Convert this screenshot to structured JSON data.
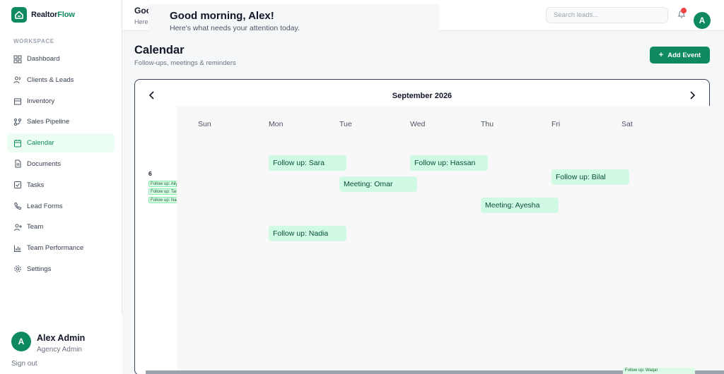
{
  "brand": {
    "name_part1": "Realtor",
    "name_part2": "Flow"
  },
  "sidebar": {
    "section_label": "WORKSPACE",
    "items": [
      {
        "label": "Dashboard",
        "icon": "grid-icon"
      },
      {
        "label": "Clients & Leads",
        "icon": "users-icon"
      },
      {
        "label": "Inventory",
        "icon": "building-icon"
      },
      {
        "label": "Sales Pipeline",
        "icon": "pipeline-icon"
      },
      {
        "label": "Calendar",
        "icon": "calendar-icon",
        "active": true
      },
      {
        "label": "Documents",
        "icon": "document-icon"
      },
      {
        "label": "Tasks",
        "icon": "checkbox-icon"
      },
      {
        "label": "Lead Forms",
        "icon": "phone-icon"
      },
      {
        "label": "Team",
        "icon": "user-plus-icon"
      },
      {
        "label": "Team Performance",
        "icon": "bar-chart-icon"
      },
      {
        "label": "Settings",
        "icon": "gear-icon"
      }
    ],
    "user": {
      "initial": "A",
      "name": "Alex Admin",
      "role": "Agency Admin",
      "signout": "Sign out"
    }
  },
  "topbar": {
    "greeting_clipped": "Goo",
    "sub_clipped": "Here",
    "search_placeholder": "Search leads...",
    "avatar_initial": "A"
  },
  "greeting": {
    "title": "Good morning, Alex!",
    "subtitle": "Here's what needs your attention today."
  },
  "page": {
    "title": "Calendar",
    "subtitle": "Follow-ups, meetings & reminders",
    "add_button": "Add Event"
  },
  "calendar": {
    "month": "September 2026",
    "underlay_day": "6",
    "underlay_chips": [
      "Follow up: Aliya",
      "Follow up: Tariq",
      "Follow up: Nadia"
    ],
    "weekdays": [
      "Sun",
      "Mon",
      "Tue",
      "Wed",
      "Thu",
      "Fri",
      "Sat"
    ],
    "events": [
      {
        "label": "Follow up: Sara"
      },
      {
        "label": "Follow up: Hassan"
      },
      {
        "label": "Follow up: Bilal"
      },
      {
        "label": "Meeting: Omar"
      },
      {
        "label": "Meeting: Ayesha"
      },
      {
        "label": "Follow up: Nadia"
      }
    ],
    "bottom_chip": "Follow up: Waqar"
  },
  "colors": {
    "accent": "#0f8a5f",
    "event_bg": "#d1fae5",
    "active_bg": "#ecfdf3"
  }
}
